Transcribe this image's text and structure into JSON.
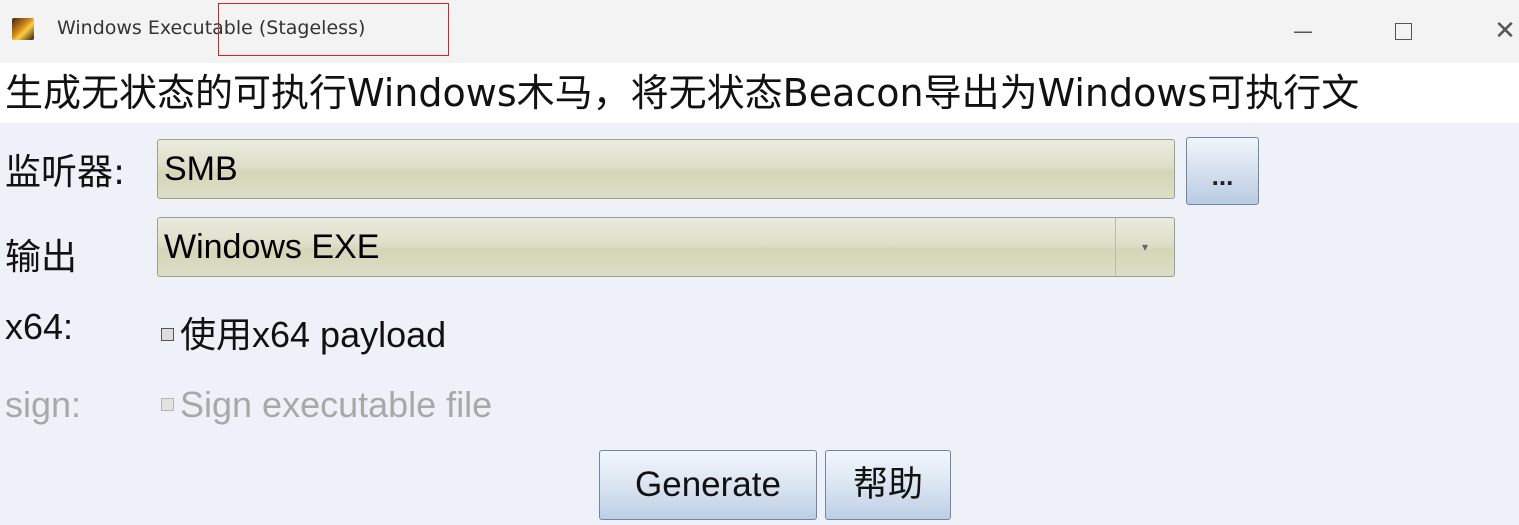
{
  "window": {
    "title": "Windows Executable (Stageless)",
    "minimize_glyph": "—",
    "close_glyph": "✕"
  },
  "description": "生成无状态的可执行Windows木马，将无状态Beacon导出为Windows可执行文",
  "listener": {
    "label": "监听器:",
    "value": "SMB",
    "browse_label": "..."
  },
  "output": {
    "label": "输出",
    "value": "Windows EXE",
    "arrow": "▾"
  },
  "x64": {
    "label": "x64:",
    "checkbox_label": "使用x64 payload",
    "checked": false
  },
  "sign": {
    "label": "sign:",
    "checkbox_label": "Sign executable file",
    "checked": false,
    "enabled": false
  },
  "buttons": {
    "generate": "Generate",
    "help": "帮助"
  },
  "colors": {
    "field_bg": "#dedfca",
    "button_bg": "#dbe5f1",
    "title_highlight": "#e02020",
    "disabled_text": "#a8a8a8"
  },
  "icons": {
    "app": "app-icon",
    "minimize": "minimize-icon",
    "maximize": "maximize-icon",
    "close": "close-icon",
    "dropdown": "chevron-down-icon"
  }
}
